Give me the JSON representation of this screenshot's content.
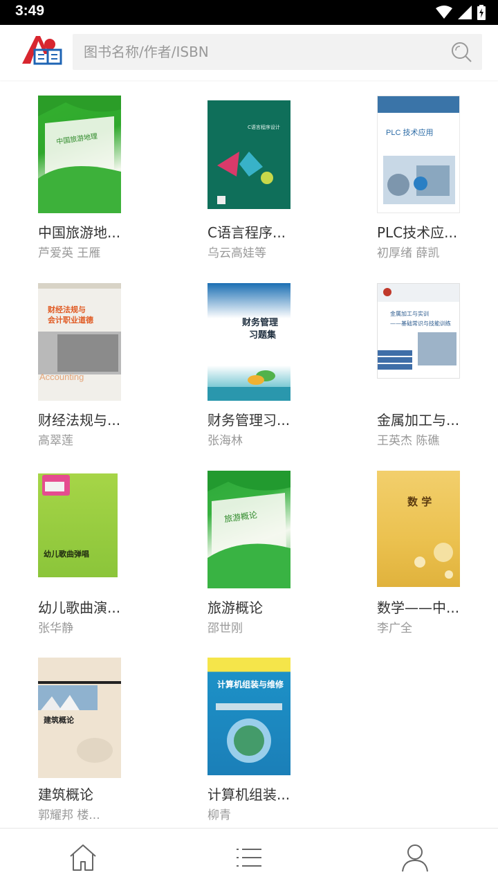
{
  "status_bar": {
    "time": "3:49"
  },
  "header": {
    "logo_text": "图书",
    "search": {
      "placeholder": "图书名称/作者/ISBN",
      "value": ""
    }
  },
  "books": [
    {
      "title": "中国旅游地...",
      "author": "芦爱英 王雁",
      "cover_title": "中国旅游地理"
    },
    {
      "title": "C语言程序...",
      "author": "乌云高娃等",
      "cover_title": "C语言程序设计"
    },
    {
      "title": "PLC技术应...",
      "author": "初厚绪 薛凯",
      "cover_title": "PLC 技术应用"
    },
    {
      "title": "财经法规与...",
      "author": "高翠莲",
      "cover_title": "财经法规与",
      "cover_title2": "会计职业道德"
    },
    {
      "title": "财务管理习...",
      "author": "张海林",
      "cover_title": "财务管理",
      "cover_title2": "习题集"
    },
    {
      "title": "金属加工与...",
      "author": "王英杰 陈礁",
      "cover_title": "金属加工与实训",
      "cover_title2": "——基础常识与技能训练"
    },
    {
      "title": "幼儿歌曲演...",
      "author": "张华静",
      "cover_title": "幼儿歌曲弹唱"
    },
    {
      "title": "旅游概论",
      "author": "邵世刚",
      "cover_title": "旅游概论"
    },
    {
      "title": "数学——中...",
      "author": "李广全",
      "cover_title": "数 学"
    },
    {
      "title": "建筑概论",
      "author": "郭耀邦 楼...",
      "cover_title": "建筑概论"
    },
    {
      "title": "计算机组装...",
      "author": "柳青",
      "cover_title": "计算机组装与维修"
    }
  ],
  "nav": {
    "items": [
      {
        "name": "home",
        "icon": "home-icon",
        "active": true
      },
      {
        "name": "list",
        "icon": "list-icon",
        "active": false
      },
      {
        "name": "profile",
        "icon": "user-icon",
        "active": false
      }
    ]
  },
  "colors": {
    "accent_red": "#d8262f",
    "accent_blue": "#1e64b4",
    "nav_icon": "#666666"
  }
}
